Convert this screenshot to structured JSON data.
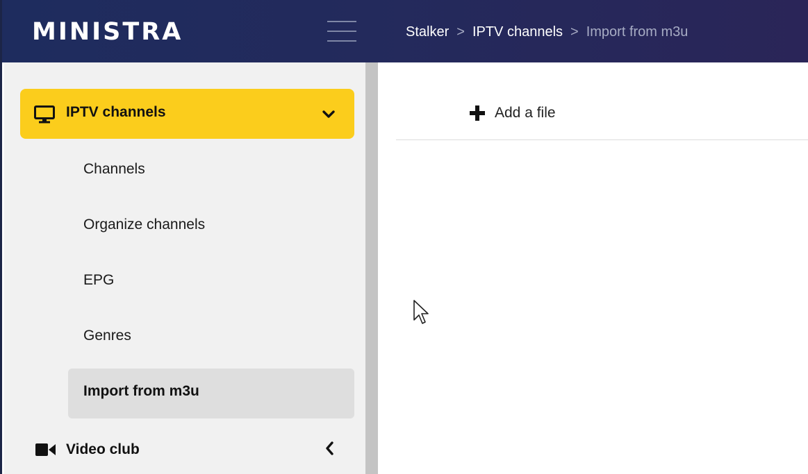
{
  "header": {
    "logo": "MINISTRA",
    "breadcrumb": {
      "item1": "Stalker",
      "item2": "IPTV channels",
      "current": "Import from m3u",
      "separator": ">"
    }
  },
  "sidebar": {
    "section_open": {
      "label": "IPTV channels",
      "icon": "monitor-icon",
      "chevron": "chevron-down-icon",
      "items": [
        {
          "label": "Channels"
        },
        {
          "label": "Organize channels"
        },
        {
          "label": "EPG"
        },
        {
          "label": "Genres"
        },
        {
          "label": "Import from m3u",
          "active": true
        }
      ]
    },
    "section_closed": {
      "label": "Video club",
      "icon": "video-camera-icon",
      "chevron": "chevron-left-icon"
    }
  },
  "main": {
    "add_file_label": "Add a file"
  },
  "colors": {
    "header_bg": "#232a5c",
    "accent": "#fbcd1c",
    "sidebar_bg": "#f1f1f1",
    "active_item_bg": "#dedede"
  }
}
